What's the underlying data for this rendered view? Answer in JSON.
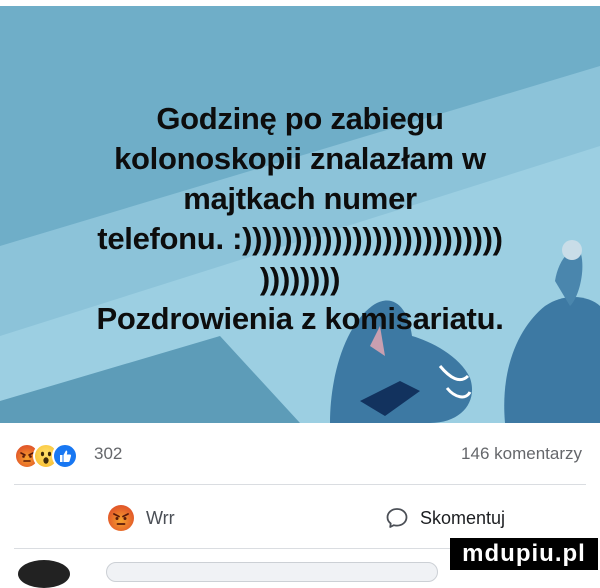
{
  "post": {
    "text_lines": [
      "Godzinę po zabiegu",
      "kolonoskopii znalazłam w",
      "majtkach numer",
      "telefonu. :))))))))))))))))))))))))))",
      "))))))))",
      "Pozdrowienia z komisariatu."
    ],
    "background_color": "#6faec8"
  },
  "reactions": {
    "icons": [
      "angry-icon",
      "wow-icon",
      "like-icon"
    ],
    "count": "302",
    "comments": "146 komentarzy"
  },
  "actions": {
    "reaction_label": "Wrr",
    "comment_label": "Skomentuj"
  },
  "watermark": "mdupiu.pl"
}
